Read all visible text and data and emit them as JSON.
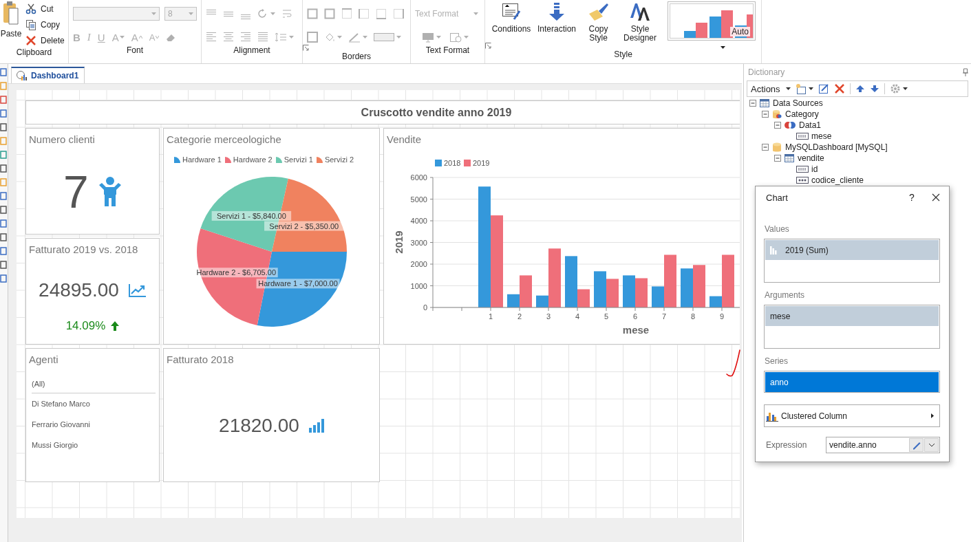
{
  "ribbon": {
    "groups": [
      {
        "kind": "clipboard",
        "label": "Clipboard",
        "disabled": false,
        "large": {
          "label": "Paste"
        },
        "small": [
          {
            "label": "Cut",
            "kind": "cut"
          },
          {
            "label": "Copy",
            "kind": "copy"
          },
          {
            "label": "Delete",
            "kind": "delete"
          }
        ]
      },
      {
        "kind": "font",
        "label": "Font",
        "disabled": true,
        "size": "8",
        "buttons": [
          {
            "label": "B",
            "kind": "bold"
          },
          {
            "label": "I",
            "kind": "italic"
          },
          {
            "label": "U",
            "kind": "underline"
          },
          {
            "label": "A",
            "kind": "color"
          },
          {
            "label": "A",
            "kind": "grow"
          },
          {
            "label": "A",
            "kind": "shrink"
          }
        ]
      },
      {
        "kind": "alignment",
        "label": "Alignment",
        "disabled": true
      },
      {
        "kind": "borders",
        "label": "Borders",
        "disabled": true
      },
      {
        "kind": "text-format",
        "label": "Text Format",
        "disabled": true,
        "format": "Text Format"
      },
      {
        "kind": "style",
        "label": "Style",
        "disabled": false,
        "buttons": [
          {
            "label": "Conditions",
            "kind": "conditions"
          },
          {
            "label": "Interaction",
            "kind": "interaction"
          },
          {
            "label": "Copy Style",
            "kind": "copy-style"
          },
          {
            "label": "Style Designer",
            "kind": "style-designer"
          }
        ],
        "gallery": "Auto"
      }
    ]
  },
  "tabs": [
    {
      "label": "Dashboard1",
      "selected": true
    }
  ],
  "dashboard": {
    "title": "Cruscotto vendite anno 2019",
    "panels": [
      {
        "kind": "count",
        "title": "Numero clienti",
        "value": "7"
      },
      {
        "kind": "chart",
        "title": "Categorie merceologiche",
        "legend": [
          {
            "color": "#3498db"
          },
          {
            "color": "#ef6f7a"
          },
          {
            "color": "#6cc9b0"
          },
          {
            "color": "#f0825f"
          }
        ],
        "chart_data": {
          "type": "pie",
          "legend": "top",
          "categories": [
            "Hardware 1",
            "Hardware 2",
            "Servizi 1",
            "Servizi 2"
          ],
          "values": [
            28.12,
            26.93,
            23.46,
            21.49
          ],
          "value_labels": [
            "Hardware 1 - $7,000.00",
            "Hardware 2 - $6,705.00",
            "Servizi 1 - $5,840.00",
            "Servizi 2 - $5,350.00"
          ]
        }
      },
      {
        "kind": "chart",
        "title": "Vendite",
        "chart_data": {
          "type": "bar",
          "legend": "top",
          "grid": true,
          "xlabel": "mese",
          "ylabel": "2019",
          "categories": [
            "1",
            "2",
            "3",
            "4",
            "5",
            "6",
            "7",
            "8",
            "9"
          ],
          "ylim": [
            0,
            6000
          ],
          "yticks": [
            0,
            1000,
            2000,
            3000,
            4000,
            5000,
            6000
          ],
          "series": [
            {
              "name": "2018",
              "color": "#3498db",
              "values": [
                5580,
                610,
                550,
                2370,
                1670,
                1480,
                970,
                1800,
                520
              ]
            },
            {
              "name": "2019",
              "color": "#ef6f7a",
              "values": [
                4250,
                1480,
                2720,
                840,
                1320,
                1350,
                2430,
                1960,
                2430
              ]
            }
          ]
        }
      },
      {
        "kind": "comparison",
        "title": "Fatturato 2019 vs. 2018",
        "value": "24895.00",
        "delta": "14.09%",
        "rising": true
      },
      {
        "kind": "list",
        "title": "Agenti",
        "items": [
          "(All)",
          "Di Stefano Marco",
          "Ferrario Giovanni",
          "Mussi Giorgio"
        ]
      },
      {
        "kind": "total",
        "title": "Fatturato 2018",
        "value": "21820.00"
      }
    ]
  },
  "dictionary": {
    "title": "Dictionary",
    "actions": "Actions",
    "tree": [
      {
        "label": "Data Sources",
        "kind": "table",
        "expanded": true,
        "children": [
          {
            "label": "Category",
            "kind": "category",
            "expanded": true,
            "children": [
              {
                "label": "Data1",
                "kind": "relation",
                "expanded": true,
                "children": [
                  {
                    "label": "mese",
                    "kind": "number-field"
                  }
                ]
              }
            ]
          },
          {
            "label": "MySQLDashboard [MySQL]",
            "kind": "database",
            "expanded": true,
            "children": [
              {
                "label": "vendite",
                "kind": "table",
                "expanded": true,
                "children": [
                  {
                    "label": "id",
                    "kind": "number-field"
                  },
                  {
                    "label": "codice_cliente",
                    "kind": "text-field"
                  }
                ]
              }
            ]
          }
        ]
      }
    ]
  },
  "chart_dialog": {
    "title": "Chart",
    "help": "?",
    "sections": [
      {
        "kind": "values",
        "label": "Values",
        "focused": false,
        "items": [
          {
            "label": "2019 (Sum)",
            "selected": true
          }
        ]
      },
      {
        "kind": "arguments",
        "label": "Arguments",
        "focused": false,
        "items": [
          {
            "label": "mese",
            "selected": true
          }
        ]
      },
      {
        "kind": "series",
        "label": "Series",
        "focused": true,
        "items": [
          {
            "label": "anno",
            "selected": true
          }
        ]
      }
    ],
    "chart_type": "Clustered Column",
    "expression": {
      "label": "Expression",
      "value": "vendite.anno"
    }
  }
}
